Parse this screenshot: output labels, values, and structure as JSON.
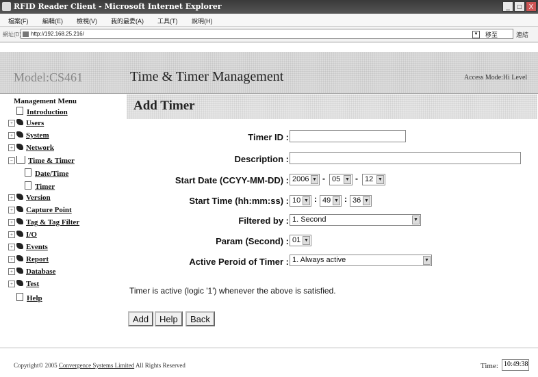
{
  "window": {
    "title": "RFID Reader Client - Microsoft Internet Explorer",
    "buttons": {
      "minimize": "_",
      "maximize": "□",
      "close": "X"
    }
  },
  "menubar": {
    "items": [
      "檔案(F)",
      "編輯(E)",
      "檢視(V)",
      "我的最愛(A)",
      "工具(T)",
      "說明(H)"
    ]
  },
  "addressbar": {
    "label": "網址(D)",
    "url": "http://192.168.25.216/",
    "go": "移至",
    "links": "連結"
  },
  "header": {
    "model": "Model:CS461",
    "title": "Time & Timer Management",
    "access": "Access Mode:Hi Level"
  },
  "sidebar": {
    "heading": "Management Menu",
    "items": [
      {
        "label": "Introduction"
      },
      {
        "label": "Users"
      },
      {
        "label": "System"
      },
      {
        "label": "Network"
      },
      {
        "label": "Time & Timer"
      },
      {
        "label": "Date/Time"
      },
      {
        "label": "Timer"
      },
      {
        "label": "Version"
      },
      {
        "label": "Capture Point"
      },
      {
        "label": "Tag & Tag Filter"
      },
      {
        "label": "I/O"
      },
      {
        "label": "Events"
      },
      {
        "label": "Report"
      },
      {
        "label": "Database"
      },
      {
        "label": "Test"
      },
      {
        "label": "Help"
      }
    ]
  },
  "form": {
    "title": "Add Timer",
    "timer_id": {
      "label": "Timer ID :",
      "value": ""
    },
    "description": {
      "label": "Description :",
      "value": ""
    },
    "start_date": {
      "label": "Start Date (CCYY-MM-DD) :",
      "year": "2006",
      "month": "05",
      "day": "12"
    },
    "start_time": {
      "label": "Start Time (hh:mm:ss) :",
      "hh": "10",
      "mm": "49",
      "ss": "36"
    },
    "filtered_by": {
      "label": "Filtered by :",
      "value": "1. Second"
    },
    "param": {
      "label": "Param (Second) :",
      "value": "01"
    },
    "active_period": {
      "label": "Active Peroid of Timer :",
      "value": "1. Always active"
    },
    "note": "Timer is active (logic '1') whenever the above is satisfied.",
    "buttons": {
      "add": "Add",
      "help": "Help",
      "back": "Back"
    }
  },
  "footer": {
    "copyright_prefix": "Copyright© 2005",
    "company": "Convergence Systems Limited",
    "rights": "All Rights Reserved",
    "time_label": "Time:",
    "time_value": "10:49:38"
  }
}
